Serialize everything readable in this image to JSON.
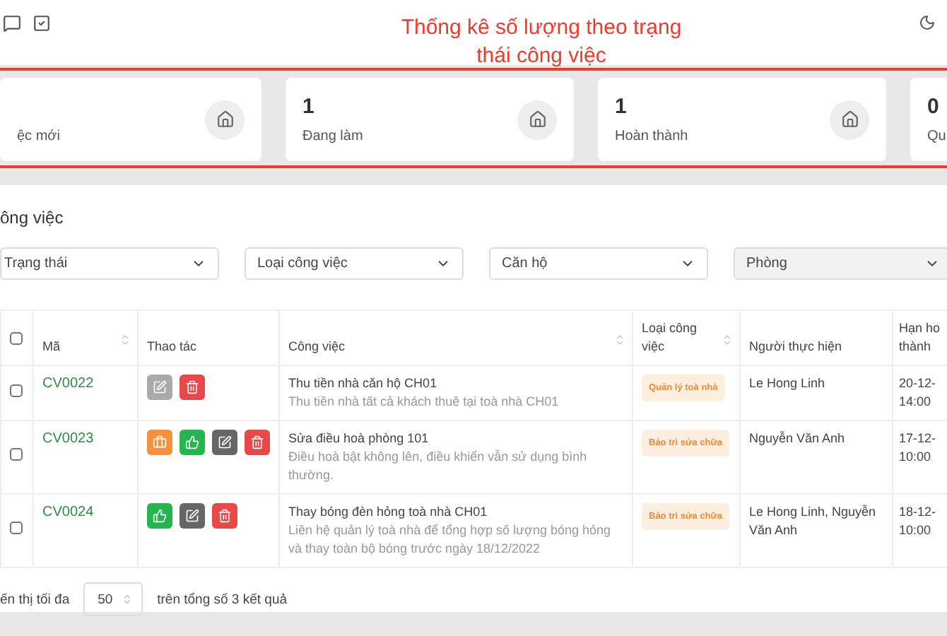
{
  "annotation": "Thống kê số lượng theo trạng\nthái công việc",
  "stats": [
    {
      "label": "ệc mới"
    },
    {
      "count": "1",
      "label": "Đang làm"
    },
    {
      "count": "1",
      "label": "Hoàn thành"
    },
    {
      "count": "0",
      "label": "Qu"
    }
  ],
  "section_title": "ông việc",
  "filters": [
    {
      "placeholder": "Trạng thái",
      "disabled": false
    },
    {
      "placeholder": "Loại công việc",
      "disabled": false
    },
    {
      "placeholder": "Căn hộ",
      "disabled": false
    },
    {
      "placeholder": "Phòng",
      "disabled": true
    }
  ],
  "table": {
    "select_all": {
      "checked": false
    },
    "columns": [
      {
        "label": "Mã",
        "sortable": true
      },
      {
        "label": "Thao tác",
        "sortable": false
      },
      {
        "label": "Công việc",
        "sortable": true
      },
      {
        "label": "Loại công\nviệc",
        "sortable": true
      },
      {
        "label": "Người thực hiện",
        "sortable": false
      },
      {
        "label": "Hạn ho\nthành",
        "sortable": false
      }
    ],
    "rows": [
      {
        "checked": false,
        "code": "CV0022",
        "actions": [
          {
            "kind": "edit",
            "disabled": true
          },
          {
            "kind": "delete",
            "disabled": false
          }
        ],
        "title": "Thu tiền nhà căn hộ CH01",
        "description": "Thu tiền nhà tất cả khách thuê tại toà nhà CH01",
        "type": "Quản lý toà nhà",
        "assignee": "Le Hong Linh",
        "deadline": "20-12-\n14:00"
      },
      {
        "checked": false,
        "code": "CV0023",
        "actions": [
          {
            "kind": "assign",
            "disabled": false
          },
          {
            "kind": "approve",
            "disabled": false
          },
          {
            "kind": "edit",
            "disabled": false
          },
          {
            "kind": "delete",
            "disabled": false
          }
        ],
        "title": "Sửa điều hoà phòng 101",
        "description": "Điều hoà bật không lên, điều khiển vẫn sử dụng bình thường.",
        "type": "Bảo trì sửa chữa",
        "assignee": "Nguyễn Văn Anh",
        "deadline": "17-12-\n10:00"
      },
      {
        "checked": false,
        "code": "CV0024",
        "actions": [
          {
            "kind": "approve",
            "disabled": false
          },
          {
            "kind": "edit",
            "disabled": false
          },
          {
            "kind": "delete",
            "disabled": false
          }
        ],
        "title": "Thay bóng đèn hỏng toà nhà CH01",
        "description": "Liên hệ quản lý toà nhà để tổng hợp số lượng bóng hỏng và thay toàn bộ bóng trước ngày 18/12/2022",
        "type": "Bảo trì sửa chữa",
        "assignee": "Le Hong Linh, Nguyễn Văn Anh",
        "deadline": "18-12-\n10:00"
      }
    ]
  },
  "footer": {
    "prefix": "ến thị tối đa",
    "page_size": "50",
    "total": "trên tổng số 3 kết quả"
  }
}
